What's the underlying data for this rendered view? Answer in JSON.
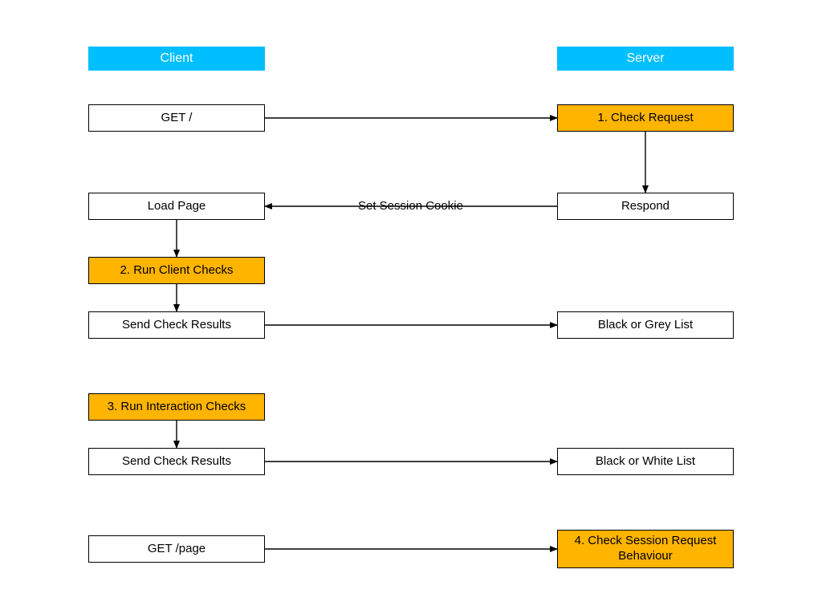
{
  "headers": {
    "client": "Client",
    "server": "Server"
  },
  "client": {
    "get_root": "GET /",
    "load_page": "Load Page",
    "run_client_checks": "2. Run Client Checks",
    "send_results_1": "Send Check Results",
    "run_interaction_checks": "3. Run Interaction Checks",
    "send_results_2": "Send Check Results",
    "get_page": "GET /page"
  },
  "server": {
    "check_request": "1. Check Request",
    "respond": "Respond",
    "grey_list": "Black or Grey List",
    "white_list": "Black or White List",
    "check_session": "4. Check Session Request Behaviour"
  },
  "edges": {
    "set_cookie": "Set Session Cookie"
  },
  "colors": {
    "header": "#00BFFF",
    "amber": "#FFB400"
  }
}
